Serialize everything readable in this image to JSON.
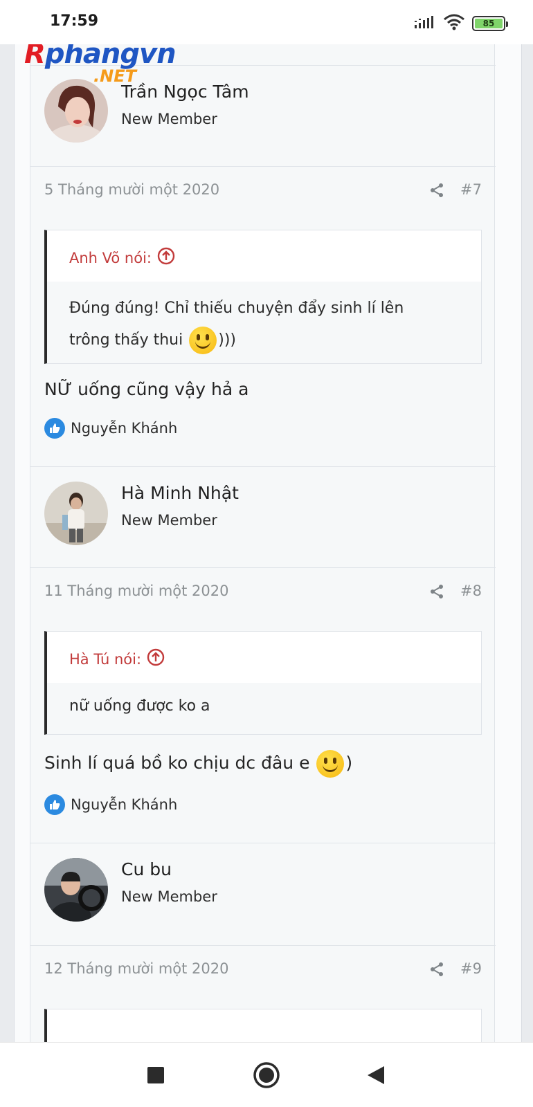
{
  "status_bar": {
    "time": "17:59",
    "battery": "85"
  },
  "logo": {
    "main_r": "R",
    "main_rest": "phangvn",
    "suffix": ".NET"
  },
  "posts": [
    {
      "user": {
        "name": "Trần Ngọc Tâm",
        "title": "New Member"
      },
      "date": "5 Tháng mười một 2020",
      "number": "#7",
      "quote_author": "Anh Võ nói:",
      "quote_text_1": "Đúng đúng! Chỉ thiếu chuyện đẩy sinh lí lên",
      "quote_text_2": "trông thấy thui",
      "quote_text_3": ")))",
      "message": "NỮ uống cũng vậy hả a",
      "reaction": "Nguyễn Khánh"
    },
    {
      "user": {
        "name": "Hà Minh Nhật",
        "title": "New Member"
      },
      "date": "11 Tháng mười một 2020",
      "number": "#8",
      "quote_author": "Hà Tú nói:",
      "quote_text_1": "nữ uống được ko a",
      "message_1": "Sinh lí quá bồ ko chịu dc đâu e",
      "message_2": ")",
      "reaction": "Nguyễn Khánh"
    },
    {
      "user": {
        "name": "Cu bu",
        "title": "New Member"
      },
      "date": "12 Tháng mười một 2020",
      "number": "#9"
    }
  ],
  "icons": {
    "share": "share-icon",
    "quote_up": "arrow-circle-up-icon",
    "like": "thumbs-up-icon",
    "nav_recent": "square-icon",
    "nav_home": "circle-icon",
    "nav_back": "triangle-back-icon"
  },
  "colors": {
    "quote_author": "#c23b3b",
    "like_badge": "#2b8ae0",
    "meta_text": "#8c9194"
  }
}
